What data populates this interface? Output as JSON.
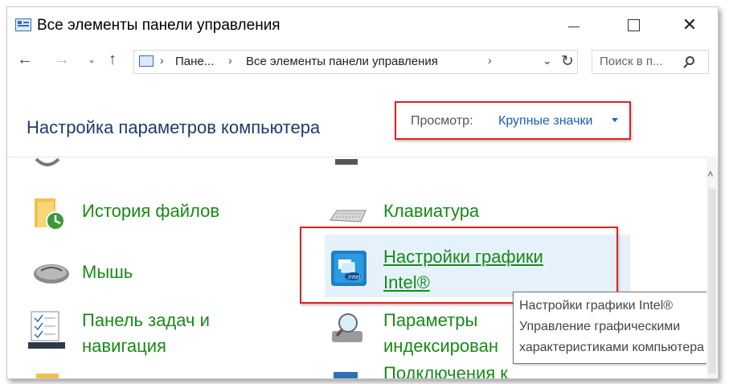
{
  "window": {
    "title": "Все элементы панели управления",
    "controls": {
      "minimize": "—",
      "maximize": "□",
      "close": "✕"
    }
  },
  "navigation": {
    "back_icon": "←",
    "forward_icon": "→",
    "recent_icon": "⌄",
    "up_icon": "↑",
    "breadcrumb": [
      "Пане...",
      "Все элементы панели управления"
    ],
    "breadcrumb_sep": "›",
    "dropdown_icon": "⌄",
    "refresh_icon": "↻",
    "search_placeholder": "Поиск в п..."
  },
  "header": {
    "title": "Настройка параметров компьютера",
    "view_label": "Просмотр:",
    "view_value": "Крупные значки"
  },
  "items": [
    {
      "label": "История файлов",
      "icon": "file-history-icon"
    },
    {
      "label": "Клавиатура",
      "icon": "keyboard-icon"
    },
    {
      "label": "Мышь",
      "icon": "mouse-icon"
    },
    {
      "label": "Настройки графики Intel®",
      "icon": "intel-graphics-icon"
    },
    {
      "label_line1": "Панель задач и",
      "label_line2": "навигация",
      "icon": "taskbar-icon"
    },
    {
      "label_line1": "Параметры",
      "label_line2": "индексирован",
      "icon": "indexing-icon"
    },
    {
      "label": "Подключения к",
      "icon": "remote-connections-icon"
    }
  ],
  "intel_label_line1": "Настройки графики ",
  "intel_label_line2": "Intel®",
  "tooltip": {
    "line1": "Настройки графики Intel®",
    "line2": "Управление графическими",
    "line3": "характеристиками компьютера"
  },
  "scrollbar": {
    "up_icon": "˄"
  },
  "colors": {
    "link_green": "#178a17",
    "highlight_red": "#e02020",
    "selection_blue": "#e5f1fb",
    "title_blue": "#1e3a6e"
  }
}
